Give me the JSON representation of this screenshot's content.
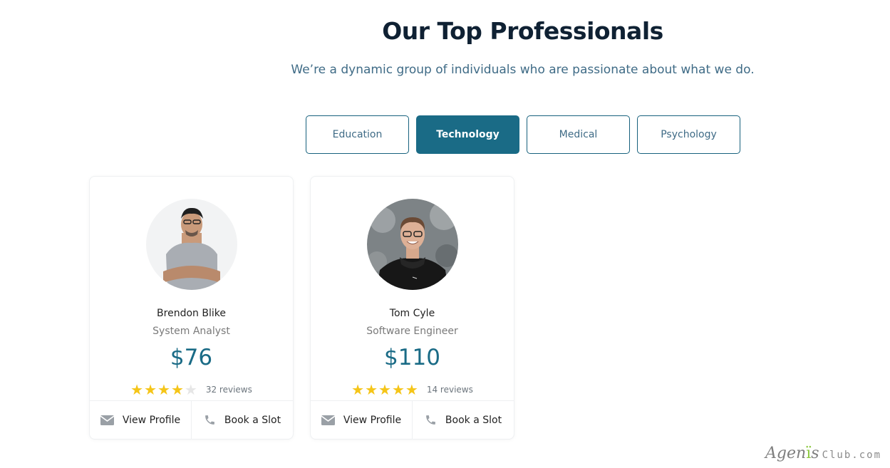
{
  "header": {
    "title": "Our Top Professionals",
    "subtitle": "We’re a dynamic group of individuals who are passionate about what we do."
  },
  "tabs": [
    {
      "label": "Education",
      "active": false
    },
    {
      "label": "Technology",
      "active": true
    },
    {
      "label": "Medical",
      "active": false
    },
    {
      "label": "Psychology",
      "active": false
    }
  ],
  "professionals": [
    {
      "name": "Brendon Blike",
      "role": "System Analyst",
      "currency": "$",
      "price": "76",
      "rating": 4,
      "rating_max": 5,
      "reviews": "32 reviews",
      "view_profile": "View Profile",
      "book_slot": "Book a Slot",
      "avatar": "person-gray-tshirt-arms-crossed"
    },
    {
      "name": "Tom Cyle",
      "role": "Software Engineer",
      "currency": "$",
      "price": "110",
      "rating": 5,
      "rating_max": 5,
      "reviews": "14 reviews",
      "view_profile": "View Profile",
      "book_slot": "Book a Slot",
      "avatar": "person-black-hoodie-smiling"
    }
  ],
  "watermark": {
    "part1": "Agen",
    "part2": "s",
    "part3": "Club.com"
  },
  "colors": {
    "accent": "#1a6b86",
    "star": "#f5c518",
    "star_empty": "#e6e6e6",
    "title": "#0f2133"
  },
  "icons": {
    "mail": "envelope-icon",
    "phone": "phone-icon",
    "star": "star-icon"
  }
}
